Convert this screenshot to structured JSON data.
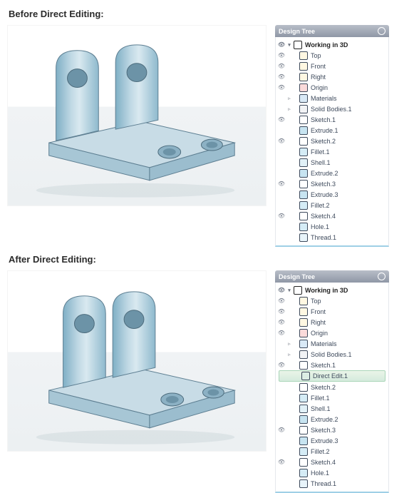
{
  "headings": {
    "before": "Before Direct Editing:",
    "after": "After Direct Editing:"
  },
  "panel": {
    "title": "Design Tree"
  },
  "tree_before": [
    {
      "eye": true,
      "twisty": "▾",
      "depth": 0,
      "icon": "ic-work3d",
      "bold": true,
      "label": "Working in 3D"
    },
    {
      "eye": true,
      "twisty": "",
      "depth": 1,
      "icon": "ic-plane",
      "bold": false,
      "label": "Top"
    },
    {
      "eye": true,
      "twisty": "",
      "depth": 1,
      "icon": "ic-plane",
      "bold": false,
      "label": "Front"
    },
    {
      "eye": true,
      "twisty": "",
      "depth": 1,
      "icon": "ic-plane",
      "bold": false,
      "label": "Right"
    },
    {
      "eye": true,
      "twisty": "",
      "depth": 1,
      "icon": "ic-origin",
      "bold": false,
      "label": "Origin"
    },
    {
      "eye": false,
      "twisty": "▹",
      "depth": 1,
      "icon": "ic-mat",
      "bold": false,
      "label": "Materials"
    },
    {
      "eye": false,
      "twisty": "▹",
      "depth": 1,
      "icon": "ic-body",
      "bold": false,
      "label": "Solid Bodies.1"
    },
    {
      "eye": true,
      "twisty": "",
      "depth": 1,
      "icon": "ic-sketch",
      "bold": false,
      "label": "Sketch.1"
    },
    {
      "eye": false,
      "twisty": "",
      "depth": 1,
      "icon": "ic-extrude",
      "bold": false,
      "label": "Extrude.1"
    },
    {
      "eye": true,
      "twisty": "",
      "depth": 1,
      "icon": "ic-sketch",
      "bold": false,
      "label": "Sketch.2"
    },
    {
      "eye": false,
      "twisty": "",
      "depth": 1,
      "icon": "ic-fillet",
      "bold": false,
      "label": "Fillet.1"
    },
    {
      "eye": false,
      "twisty": "",
      "depth": 1,
      "icon": "ic-shell",
      "bold": false,
      "label": "Shell.1"
    },
    {
      "eye": false,
      "twisty": "",
      "depth": 1,
      "icon": "ic-extrude",
      "bold": false,
      "label": "Extrude.2"
    },
    {
      "eye": true,
      "twisty": "",
      "depth": 1,
      "icon": "ic-sketch",
      "bold": false,
      "label": "Sketch.3"
    },
    {
      "eye": false,
      "twisty": "",
      "depth": 1,
      "icon": "ic-extrude",
      "bold": false,
      "label": "Extrude.3"
    },
    {
      "eye": false,
      "twisty": "",
      "depth": 1,
      "icon": "ic-fillet",
      "bold": false,
      "label": "Fillet.2"
    },
    {
      "eye": true,
      "twisty": "",
      "depth": 1,
      "icon": "ic-sketch",
      "bold": false,
      "label": "Sketch.4"
    },
    {
      "eye": false,
      "twisty": "",
      "depth": 1,
      "icon": "ic-hole",
      "bold": false,
      "label": "Hole.1"
    },
    {
      "eye": false,
      "twisty": "",
      "depth": 1,
      "icon": "ic-thread",
      "bold": false,
      "label": "Thread.1"
    }
  ],
  "tree_after": [
    {
      "eye": true,
      "twisty": "▾",
      "depth": 0,
      "icon": "ic-work3d",
      "bold": true,
      "label": "Working in 3D"
    },
    {
      "eye": true,
      "twisty": "",
      "depth": 1,
      "icon": "ic-plane",
      "bold": false,
      "label": "Top"
    },
    {
      "eye": true,
      "twisty": "",
      "depth": 1,
      "icon": "ic-plane",
      "bold": false,
      "label": "Front"
    },
    {
      "eye": true,
      "twisty": "",
      "depth": 1,
      "icon": "ic-plane",
      "bold": false,
      "label": "Right"
    },
    {
      "eye": true,
      "twisty": "",
      "depth": 1,
      "icon": "ic-origin",
      "bold": false,
      "label": "Origin"
    },
    {
      "eye": false,
      "twisty": "▹",
      "depth": 1,
      "icon": "ic-mat",
      "bold": false,
      "label": "Materials"
    },
    {
      "eye": false,
      "twisty": "▹",
      "depth": 1,
      "icon": "ic-body",
      "bold": false,
      "label": "Solid Bodies.1"
    },
    {
      "eye": true,
      "twisty": "",
      "depth": 1,
      "icon": "ic-sketch",
      "bold": false,
      "label": "Sketch.1"
    },
    {
      "eye": false,
      "twisty": "",
      "depth": 1,
      "icon": "ic-direct",
      "bold": false,
      "label": "Direct Edit.1",
      "highlight": true
    },
    {
      "eye": false,
      "twisty": "",
      "depth": 1,
      "icon": "ic-sketch",
      "bold": false,
      "label": "Sketch.2"
    },
    {
      "eye": false,
      "twisty": "",
      "depth": 1,
      "icon": "ic-fillet",
      "bold": false,
      "label": "Fillet.1"
    },
    {
      "eye": false,
      "twisty": "",
      "depth": 1,
      "icon": "ic-shell",
      "bold": false,
      "label": "Shell.1"
    },
    {
      "eye": false,
      "twisty": "",
      "depth": 1,
      "icon": "ic-extrude",
      "bold": false,
      "label": "Extrude.2"
    },
    {
      "eye": true,
      "twisty": "",
      "depth": 1,
      "icon": "ic-sketch",
      "bold": false,
      "label": "Sketch.3"
    },
    {
      "eye": false,
      "twisty": "",
      "depth": 1,
      "icon": "ic-extrude",
      "bold": false,
      "label": "Extrude.3"
    },
    {
      "eye": false,
      "twisty": "",
      "depth": 1,
      "icon": "ic-fillet",
      "bold": false,
      "label": "Fillet.2"
    },
    {
      "eye": true,
      "twisty": "",
      "depth": 1,
      "icon": "ic-sketch",
      "bold": false,
      "label": "Sketch.4"
    },
    {
      "eye": false,
      "twisty": "",
      "depth": 1,
      "icon": "ic-hole",
      "bold": false,
      "label": "Hole.1"
    },
    {
      "eye": false,
      "twisty": "",
      "depth": 1,
      "icon": "ic-thread",
      "bold": false,
      "label": "Thread.1"
    }
  ]
}
